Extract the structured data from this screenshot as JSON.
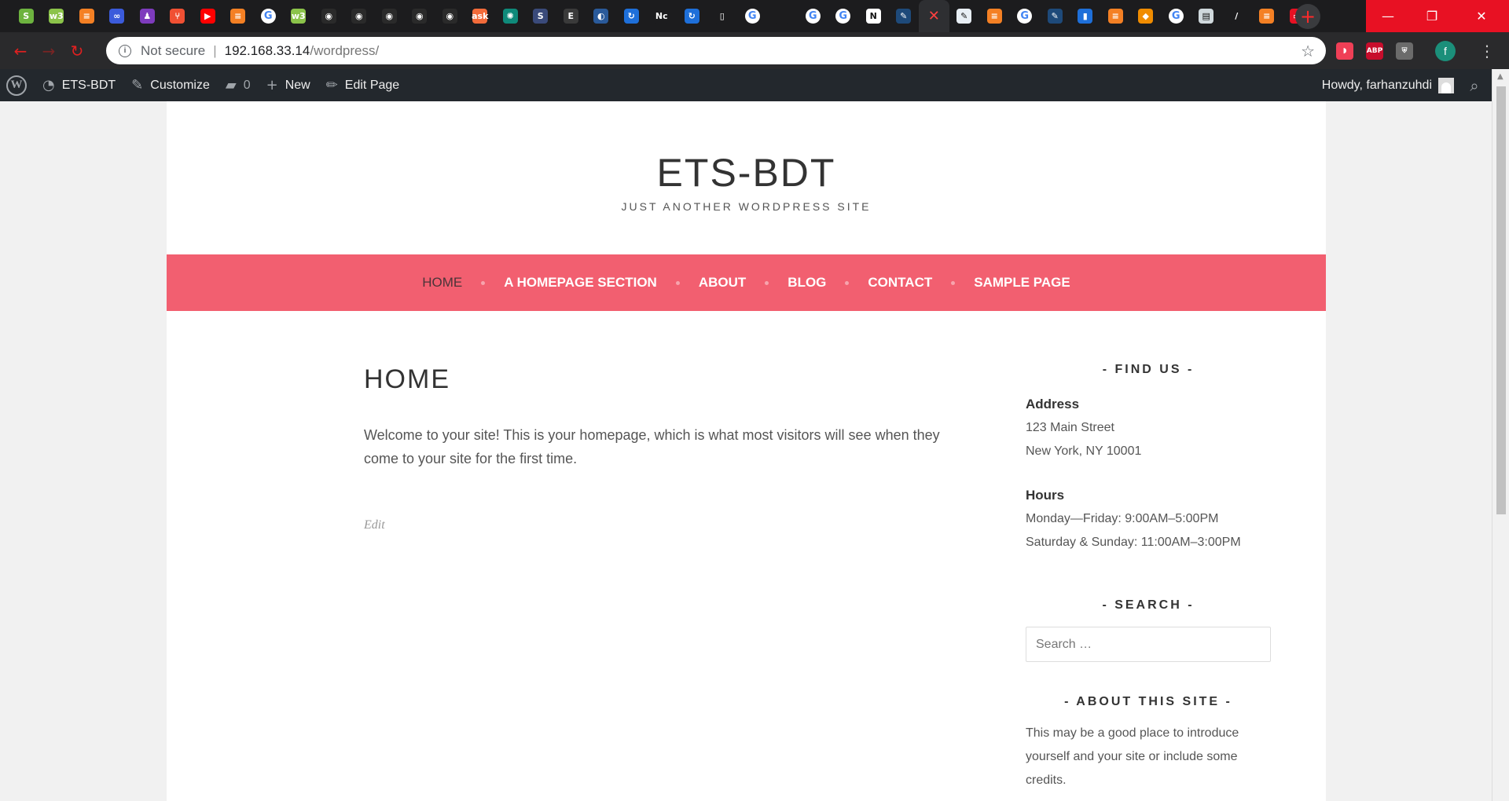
{
  "browser": {
    "tabs": [
      {
        "icon": "spring-icon",
        "color": "#6db33f",
        "glyph": "S"
      },
      {
        "icon": "w3schools-icon",
        "color": "#8bc34a",
        "glyph": "w3"
      },
      {
        "icon": "stackoverflow-icon",
        "color": "#f48024",
        "glyph": "≡"
      },
      {
        "icon": "cloud-icon",
        "color": "#3b5bdb",
        "glyph": "∞"
      },
      {
        "icon": "profile-icon",
        "color": "#7e3bbd",
        "glyph": "♟"
      },
      {
        "icon": "git-icon",
        "color": "#f05033",
        "glyph": "⑂"
      },
      {
        "icon": "youtube-icon",
        "color": "#ff0000",
        "glyph": "▶"
      },
      {
        "icon": "stackoverflow-icon",
        "color": "#f48024",
        "glyph": "≡"
      },
      {
        "icon": "google-icon",
        "color": "#ffffff",
        "glyph": "G"
      },
      {
        "icon": "w3schools-icon",
        "color": "#8bc34a",
        "glyph": "w3"
      },
      {
        "icon": "github-icon",
        "color": "#2a2a2a",
        "glyph": "◉"
      },
      {
        "icon": "github-icon",
        "color": "#2a2a2a",
        "glyph": "◉"
      },
      {
        "icon": "github-icon",
        "color": "#2a2a2a",
        "glyph": "◉"
      },
      {
        "icon": "github-icon",
        "color": "#2a2a2a",
        "glyph": "◉"
      },
      {
        "icon": "github-icon",
        "color": "#2a2a2a",
        "glyph": "◉"
      },
      {
        "icon": "ask-icon",
        "color": "#f26b3a",
        "glyph": "ask"
      },
      {
        "icon": "gear-icon",
        "color": "#0f8a7a",
        "glyph": "✺"
      },
      {
        "icon": "s-icon",
        "color": "#3a4a7a",
        "glyph": "S"
      },
      {
        "icon": "e-icon",
        "color": "#3a3a3a",
        "glyph": "E"
      },
      {
        "icon": "shield-icon",
        "color": "#2a5a9a",
        "glyph": "◐"
      },
      {
        "icon": "sync-icon",
        "color": "#1e6fd9",
        "glyph": "↻"
      },
      {
        "icon": "netflix-icon",
        "color": "#1c1c1e",
        "glyph": "Nc"
      },
      {
        "icon": "sync-icon",
        "color": "#1e6fd9",
        "glyph": "↻"
      },
      {
        "icon": "pdf-icon",
        "color": "#1c1c1e",
        "glyph": "▯"
      },
      {
        "icon": "google-icon",
        "color": "#ffffff",
        "glyph": "G"
      },
      {
        "icon": "blank-icon",
        "color": "#1c1c1e",
        "glyph": ""
      },
      {
        "icon": "google-icon",
        "color": "#ffffff",
        "glyph": "G"
      },
      {
        "icon": "google-icon",
        "color": "#ffffff",
        "glyph": "G"
      },
      {
        "icon": "notion-icon",
        "color": "#ffffff",
        "glyph": "N"
      },
      {
        "icon": "leaf-icon",
        "color": "#1e4a7a",
        "glyph": "✎"
      },
      {
        "icon": "close-icon",
        "color": "active",
        "glyph": "✕"
      },
      {
        "icon": "leaf-icon",
        "color": "#e8eef5",
        "glyph": "✎"
      },
      {
        "icon": "stackoverflow-icon",
        "color": "#f48024",
        "glyph": "≡"
      },
      {
        "icon": "google-icon",
        "color": "#ffffff",
        "glyph": "G"
      },
      {
        "icon": "leaf-icon",
        "color": "#1e4a7a",
        "glyph": "✎"
      },
      {
        "icon": "database-icon",
        "color": "#1e6fd9",
        "glyph": "▮"
      },
      {
        "icon": "stackoverflow-icon",
        "color": "#f48024",
        "glyph": "≡"
      },
      {
        "icon": "diamond-icon",
        "color": "#f08c00",
        "glyph": "◆"
      },
      {
        "icon": "google-icon",
        "color": "#ffffff",
        "glyph": "G"
      },
      {
        "icon": "doc-icon",
        "color": "#cfd8dc",
        "glyph": "▤"
      },
      {
        "icon": "pen-icon",
        "color": "#1c1c1e",
        "glyph": "/"
      },
      {
        "icon": "stackoverflow-icon",
        "color": "#f48024",
        "glyph": "≡"
      },
      {
        "icon": "window-icon",
        "color": "#e81123",
        "glyph": "▭"
      }
    ],
    "new_tab_glyph": "+",
    "window": {
      "minimize": "—",
      "restore": "❐",
      "close": "✕"
    },
    "nav": {
      "back": "←",
      "forward": "→",
      "reload": "↻"
    },
    "address": {
      "security": "Not secure",
      "separator": "|",
      "host": "192.168.33.14",
      "path": "/wordpress/"
    },
    "extensions": [
      {
        "icon": "pocket-icon",
        "color": "#ef3f56",
        "glyph": "◗"
      },
      {
        "icon": "adblock-plus-icon",
        "color": "#c70d2c",
        "glyph": "ABP"
      },
      {
        "icon": "shield-extension-icon",
        "color": "#6b6b6b",
        "glyph": "⛨"
      }
    ],
    "profile_letter": "f"
  },
  "admin_bar": {
    "site_name": "ETS-BDT",
    "customize": "Customize",
    "comments": "0",
    "new": "New",
    "edit_page": "Edit Page",
    "howdy": "Howdy, farhanzuhdi"
  },
  "site": {
    "title": "ETS-BDT",
    "description": "JUST ANOTHER WORDPRESS SITE",
    "nav": [
      "HOME",
      "A HOMEPAGE SECTION",
      "ABOUT",
      "BLOG",
      "CONTACT",
      "SAMPLE PAGE"
    ],
    "accent": "#f25f70"
  },
  "page": {
    "title": "HOME",
    "content": "Welcome to your site! This is your homepage, which is what most visitors will see when they come to your site for the first time.",
    "edit": "Edit"
  },
  "sidebar": {
    "find_us_title": "- FIND US -",
    "address_label": "Address",
    "address_line1": "123 Main Street",
    "address_line2": "New York, NY 10001",
    "hours_label": "Hours",
    "hours_line1": "Monday—Friday: 9:00AM–5:00PM",
    "hours_line2": "Saturday & Sunday: 11:00AM–3:00PM",
    "search_title": "- SEARCH -",
    "search_placeholder": "Search …",
    "about_title": "- ABOUT THIS SITE -",
    "about_text": "This may be a good place to introduce yourself and your site or include some credits."
  }
}
